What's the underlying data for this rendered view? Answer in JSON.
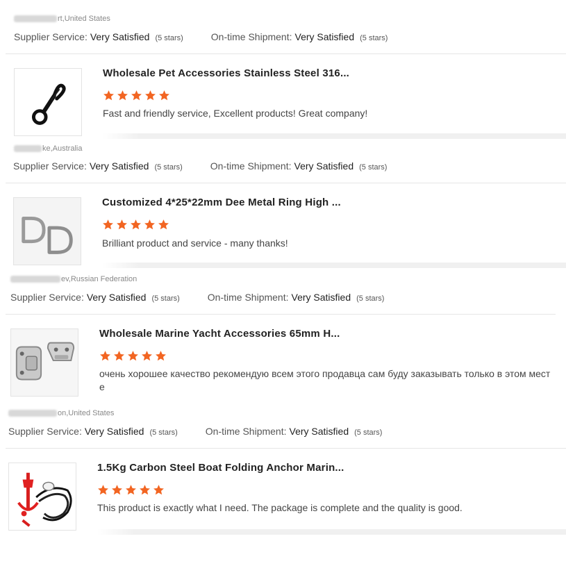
{
  "reviews": [
    {
      "location": "rt,United States",
      "supplier_label": "Supplier Service:",
      "supplier_value": "Very Satisfied",
      "supplier_stars": "(5 stars)",
      "shipment_label": "On-time Shipment:",
      "shipment_value": "Very Satisfied",
      "shipment_stars": "(5 stars)"
    },
    {
      "product_title": "Wholesale Pet Accessories Stainless Steel 316...",
      "rating": 5,
      "comment": "Fast and friendly service, Excellent products! Great company!",
      "product_image": "black-snap-hook-image",
      "location": "ke,Australia",
      "supplier_label": "Supplier Service:",
      "supplier_value": "Very Satisfied",
      "supplier_stars": "(5 stars)",
      "shipment_label": "On-time Shipment:",
      "shipment_value": "Very Satisfied",
      "shipment_stars": "(5 stars)"
    },
    {
      "product_title": "Customized 4*25*22mm Dee Metal Ring High ...",
      "rating": 5,
      "comment": "Brilliant product and service - many thanks!",
      "product_image": "d-rings-image",
      "location": "ev,Russian Federation",
      "supplier_label": "Supplier Service:",
      "supplier_value": "Very Satisfied",
      "supplier_stars": "(5 stars)",
      "shipment_label": "On-time Shipment:",
      "shipment_value": "Very Satisfied",
      "shipment_stars": "(5 stars)"
    },
    {
      "product_title": "Wholesale Marine Yacht Accessories 65mm H...",
      "rating": 5,
      "comment": "очень хорошее качество рекомендую всем этого продавца сам буду заказывать только в этом мест е",
      "product_image": "hinge-hardware-image",
      "location": "on,United States",
      "supplier_label": "Supplier Service:",
      "supplier_value": "Very Satisfied",
      "supplier_stars": "(5 stars)",
      "shipment_label": "On-time Shipment:",
      "shipment_value": "Very Satisfied",
      "shipment_stars": "(5 stars)"
    },
    {
      "product_title": "1.5Kg Carbon Steel Boat Folding Anchor Marin...",
      "rating": 5,
      "comment": "This product is exactly what I need. The package is complete and the quality is good.",
      "product_image": "folding-anchor-image"
    }
  ],
  "colors": {
    "star": "#f26522",
    "separator": "#e6e6e6",
    "muted_text": "#888888"
  }
}
